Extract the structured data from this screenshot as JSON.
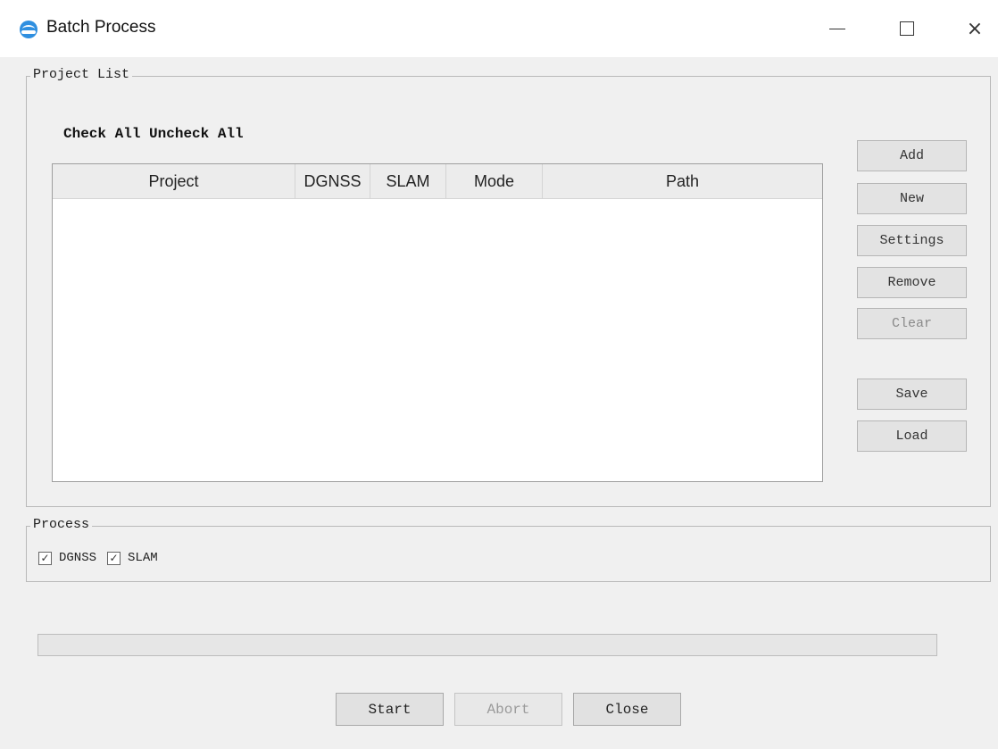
{
  "window": {
    "title": "Batch Process",
    "app_icon": "app-logo-icon",
    "controls": {
      "minimize": "minimize-icon",
      "maximize": "maximize-icon",
      "close": "×"
    }
  },
  "project_list": {
    "group_label": "Project List",
    "check_all": "Check All",
    "uncheck_all": "Uncheck All",
    "table": {
      "columns": [
        "Project",
        "DGNSS",
        "SLAM",
        "Mode",
        "Path"
      ],
      "rows": []
    },
    "buttons": {
      "add": "Add",
      "new": "New",
      "settings": "Settings",
      "remove": "Remove",
      "clear": "Clear",
      "save": "Save",
      "load": "Load"
    }
  },
  "process": {
    "group_label": "Process",
    "options": [
      {
        "label": "DGNSS",
        "checked": true
      },
      {
        "label": "SLAM",
        "checked": true
      }
    ]
  },
  "progress": {
    "value": 0
  },
  "footer": {
    "start": "Start",
    "abort": "Abort",
    "close": "Close"
  },
  "colors": {
    "progress_fill": "#06b025"
  }
}
